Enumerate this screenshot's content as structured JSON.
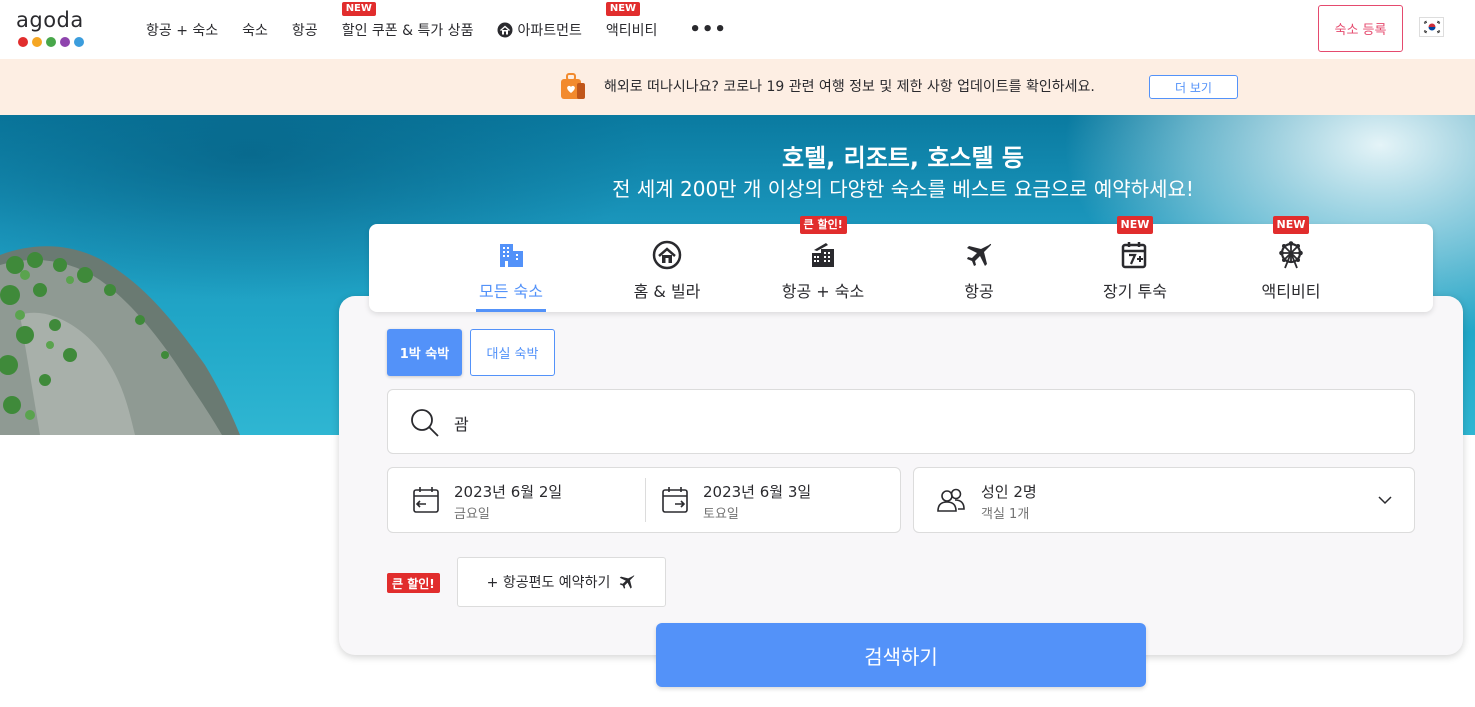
{
  "header": {
    "logo": "agoda",
    "logo_colors": [
      "#e12d2d",
      "#f5a623",
      "#48a74a",
      "#8e44ad",
      "#3b9ddd"
    ],
    "nav": [
      {
        "label": "항공 + 숙소",
        "badge": ""
      },
      {
        "label": "숙소",
        "badge": ""
      },
      {
        "label": "항공",
        "badge": ""
      },
      {
        "label": "할인 쿠폰 & 특가 상품",
        "badge": "NEW"
      },
      {
        "label": "아파트먼트",
        "badge": "",
        "icon": "home-icon"
      },
      {
        "label": "액티비티",
        "badge": "NEW"
      }
    ],
    "more": "•••",
    "register_label": "숙소 등록",
    "language_flag": "korea-flag"
  },
  "notice": {
    "icon": "travel-bag-icon",
    "text": "해외로 떠나시나요? 코로나 19 관련 여행 정보 및 제한 사항 업데이트를 확인하세요.",
    "button_label": "더 보기"
  },
  "hero": {
    "title": "호텔, 리조트, 호스텔 등",
    "subtitle": "전 세계 200만 개 이상의 다양한 숙소를 베스트 요금으로 예약하세요!"
  },
  "tabs": [
    {
      "label": "모든 숙소",
      "icon": "hotel-building-icon",
      "badge": "",
      "active": true
    },
    {
      "label": "홈 & 빌라",
      "icon": "home-icon",
      "badge": "",
      "active": false
    },
    {
      "label": "항공 + 숙소",
      "icon": "flight-hotel-icon",
      "badge": "큰 할인!",
      "active": false
    },
    {
      "label": "항공",
      "icon": "airplane-icon",
      "badge": "",
      "active": false
    },
    {
      "label": "장기 투숙",
      "icon": "calendar-7plus-icon",
      "badge": "NEW",
      "active": false
    },
    {
      "label": "액티비티",
      "icon": "ferris-wheel-icon",
      "badge": "NEW",
      "active": false
    }
  ],
  "stay_type": {
    "overnight_label": "1박 숙박",
    "dayuse_label": "대실 숙박",
    "selected": "overnight"
  },
  "search": {
    "value": "괌"
  },
  "dates": {
    "checkin_main": "2023년 6월 2일",
    "checkin_day": "금요일",
    "checkout_main": "2023년 6월 3일",
    "checkout_day": "토요일"
  },
  "guests": {
    "main": "성인 2명",
    "sub": "객실 1개"
  },
  "promo": {
    "badge": "큰 할인!",
    "flight_label": "+ 항공편도 예약하기"
  },
  "search_button": "검색하기",
  "colors": {
    "accent": "#5392f9",
    "badge_red": "#e12d2d",
    "register_pink": "#e54a6e",
    "notice_bg": "#fdeee3"
  }
}
